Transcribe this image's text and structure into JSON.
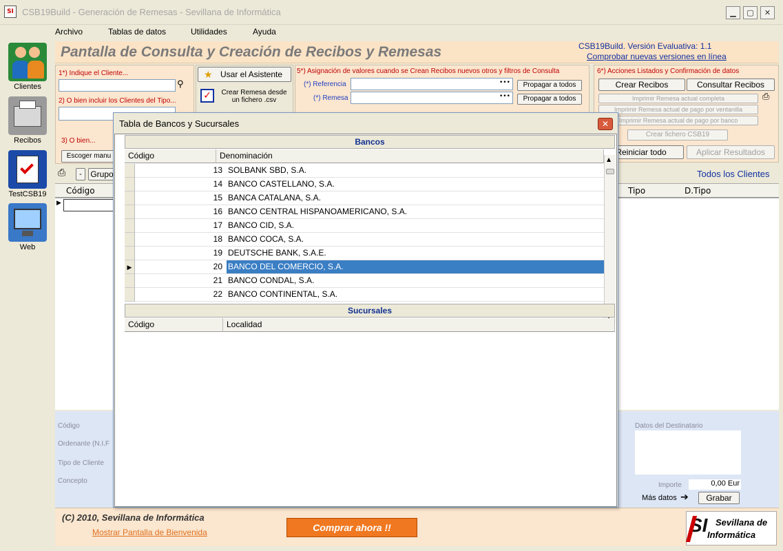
{
  "window": {
    "title": "CSB19Build - Generación de Remesas - Sevillana de Informática",
    "logo_text": "SI",
    "minimize": "▁",
    "maximize": "▢",
    "close": "✕"
  },
  "menu": [
    "Archivo",
    "Tablas de datos",
    "Utilidades",
    "Ayuda"
  ],
  "sidebar": [
    {
      "label": "Clientes",
      "icon": "people-icon",
      "color": "#2a8a3a"
    },
    {
      "label": "Recibos",
      "icon": "printer-icon",
      "color": "#8a8a8a"
    },
    {
      "label": "TestCSB19",
      "icon": "checklist-icon",
      "color": "#1c4aa8"
    },
    {
      "label": "Web",
      "icon": "monitor-icon",
      "color": "#3a78c8"
    }
  ],
  "header": {
    "title": "Pantalla de Consulta y Creación de Recibos y Remesas",
    "version": "CSB19Build. Versión Evaluativa:  1.1",
    "update_link": "Comprobar nuevas versiones en línea"
  },
  "panel_client": {
    "label1": "1*) Indique el Cliente...",
    "label2": "2) O bien incluir los Clientes del Tipo...",
    "label3": "3) O bien...",
    "manual_btn": "Escoger manu"
  },
  "panel_wizard": {
    "wizard_btn": "Usar el Asistente",
    "csv_btn": "Crear Remesa desde un fichero .csv"
  },
  "panel_assign": {
    "title": "5*) Asignación de valores cuando se Crean Recibos nuevos otros y filtros de Consulta",
    "referencia": "(*) Referencia",
    "remesa": "(*) Remesa",
    "propagar": "Propagar a todos",
    "dots": "•••"
  },
  "panel_actions": {
    "title": "6*) Acciones Listados y Confirmación de datos",
    "crear": "Crear Recibos",
    "consultar": "Consultar Recibos",
    "imp_completa": "Imprimir Remesa actual completa",
    "imp_ventanilla": "Imprimir Remesa actual de pago por ventanilla",
    "imp_banco": "Imprimir Remesa actual de pago por banco",
    "fichero": "Crear fichero CSB19",
    "reiniciar": "Reiniciar todo",
    "aplicar": "Aplicar Resultados"
  },
  "grid": {
    "group_btn": "Grupo",
    "minus_btn": "-",
    "col_codigo": "Código",
    "col_tipo": "Tipo",
    "col_dtipo": "D.Tipo",
    "filter": "Todos los Clientes"
  },
  "detail": {
    "codigo": "Código",
    "ordenante": "Ordenante (N.I.F",
    "tipo_cliente": "Tipo de Cliente",
    "concepto": "Concepto",
    "destinatario": "Datos del Destinatario",
    "importe_label": "Importe",
    "importe_value": "0,00 Eur",
    "mas_datos": "Más datos",
    "grabar": "Grabar"
  },
  "footer": {
    "copyright": "(C) 2010, Sevillana de Informática",
    "welcome": "Mostrar Pantalla de Bienvenida",
    "buy": "Comprar ahora !!",
    "brand_mark": "SI",
    "brand_text1": "Sevillana de",
    "brand_text2": "Informática"
  },
  "dialog": {
    "title": "Tabla de Bancos y Sucursales",
    "close": "✕",
    "banks_title": "Bancos",
    "banks_cols": [
      "Código",
      "Denominación"
    ],
    "banks": [
      {
        "code": "13",
        "name": "SOLBANK SBD, S.A."
      },
      {
        "code": "14",
        "name": "BANCO CASTELLANO, S.A."
      },
      {
        "code": "15",
        "name": "BANCA CATALANA, S.A."
      },
      {
        "code": "16",
        "name": "BANCO CENTRAL HISPANOAMERICANO, S.A."
      },
      {
        "code": "17",
        "name": "BANCO CID, S.A."
      },
      {
        "code": "18",
        "name": "BANCO COCA, S.A."
      },
      {
        "code": "19",
        "name": "DEUTSCHE BANK, S.A.E."
      },
      {
        "code": "20",
        "name": "BANCO DEL COMERCIO, S.A."
      },
      {
        "code": "21",
        "name": "BANCO CONDAL, S.A."
      },
      {
        "code": "22",
        "name": "BANCO CONTINENTAL, S.A."
      }
    ],
    "selected_code": "20",
    "branches_title": "Sucursales",
    "branches_cols": [
      "Código",
      "Localidad"
    ]
  }
}
